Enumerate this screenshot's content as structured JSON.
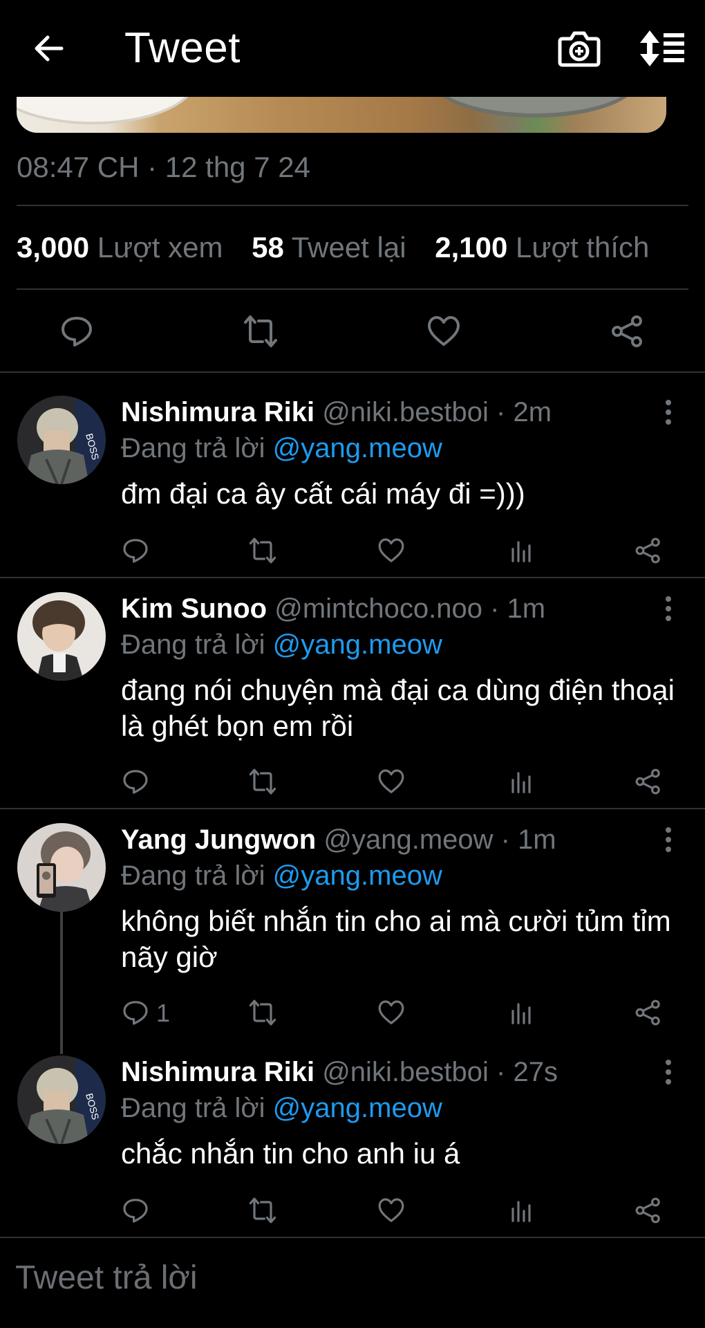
{
  "header": {
    "title": "Tweet",
    "back_icon": "arrow-left-icon",
    "camera_icon": "camera-plus-icon",
    "sort_icon": "sort-icon"
  },
  "tweet": {
    "timestamp": "08:47 CH · 12 thg 7 24",
    "stats": {
      "views_count": "3,000",
      "views_label": "Lượt xem",
      "retweets_count": "58",
      "retweets_label": "Tweet lại",
      "likes_count": "2,100",
      "likes_label": "Lượt thích"
    }
  },
  "replies": [
    {
      "name": "Nishimura Riki",
      "handle": "@niki.bestboi · 2m",
      "replying_prefix": "Đang trả lời",
      "mention": "@yang.meow",
      "text": "đm đại ca ây cất cái máy đi =)))",
      "reply_count": ""
    },
    {
      "name": "Kim Sunoo",
      "handle": "@mintchoco.noo · 1m",
      "replying_prefix": "Đang trả lời",
      "mention": "@yang.meow",
      "text": "đang nói chuyện mà đại ca dùng điện thoại là ghét bọn em rồi",
      "reply_count": ""
    },
    {
      "name": "Yang Jungwon",
      "handle": "@yang.meow · 1m",
      "replying_prefix": "Đang trả lời",
      "mention": "@yang.meow",
      "text": "không biết nhắn tin cho ai mà cười tủm tỉm nãy giờ",
      "reply_count": "1"
    },
    {
      "name": "Nishimura Riki",
      "handle": "@niki.bestboi · 27s",
      "replying_prefix": "Đang trả lời",
      "mention": "@yang.meow",
      "text": "chắc nhắn tin cho anh iu á",
      "reply_count": ""
    }
  ],
  "composer": {
    "placeholder": "Tweet trả lời"
  },
  "colors": {
    "background": "#000000",
    "text_primary": "#ffffff",
    "text_secondary": "#71767b",
    "mention": "#1d9bf0",
    "divider": "#2f3336"
  }
}
